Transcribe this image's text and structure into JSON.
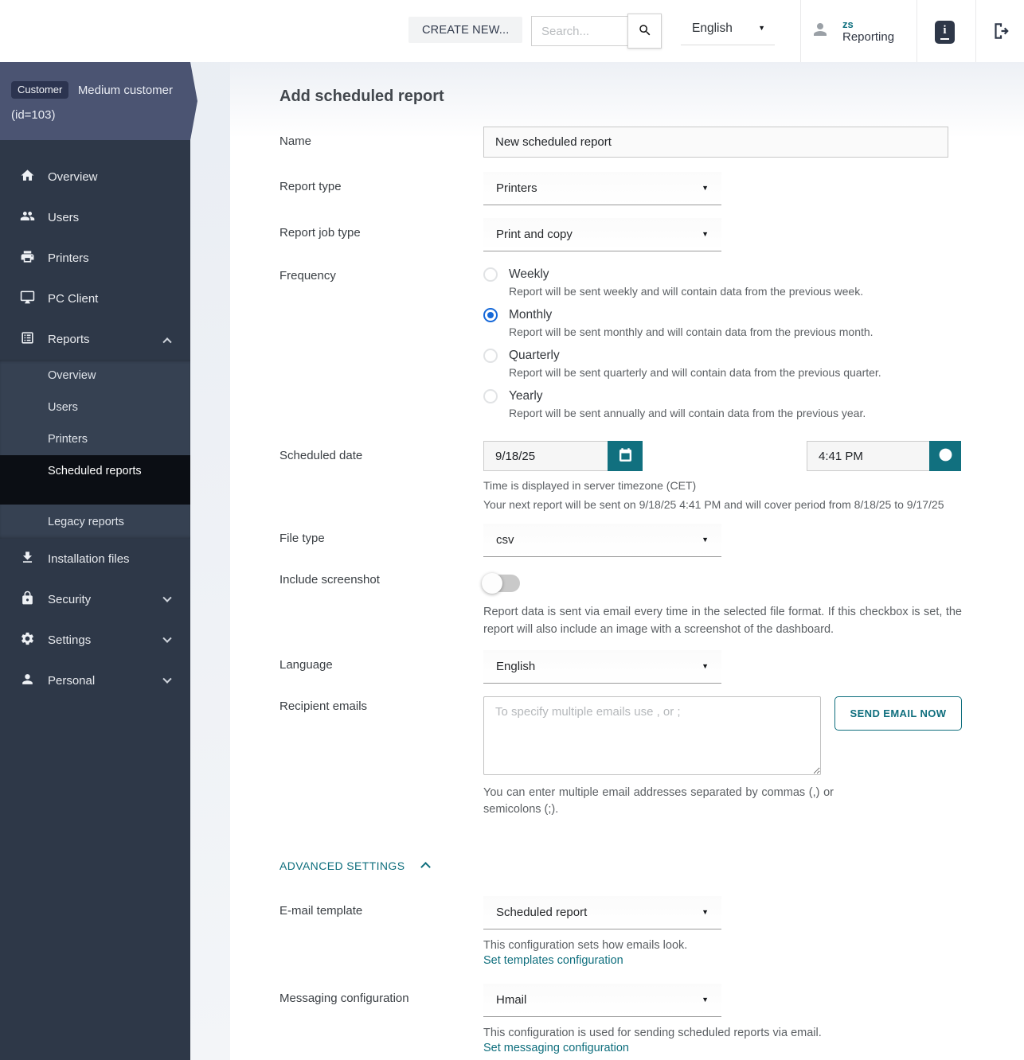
{
  "header": {
    "create_new_label": "CREATE NEW...",
    "search_placeholder": "Search...",
    "language_value": "English",
    "user_initials": "zs",
    "user_name": "Reporting"
  },
  "sidebar": {
    "customer": {
      "badge": "Customer",
      "name": "Medium customer",
      "id_line": "(id=103)"
    },
    "nav": [
      {
        "label": "Overview",
        "icon": "home-icon"
      },
      {
        "label": "Users",
        "icon": "group-icon"
      },
      {
        "label": "Printers",
        "icon": "printer-icon"
      },
      {
        "label": "PC Client",
        "icon": "monitor-icon"
      },
      {
        "label": "Reports",
        "icon": "report-list-icon",
        "expanded": true
      }
    ],
    "reports_submenu": [
      {
        "label": "Overview",
        "active": false
      },
      {
        "label": "Users",
        "active": false
      },
      {
        "label": "Printers",
        "active": false
      },
      {
        "label": "Scheduled reports",
        "active": true
      },
      {
        "label": "Legacy reports",
        "active": false
      }
    ],
    "nav_bottom": [
      {
        "label": "Installation files",
        "icon": "download-icon",
        "collapsible": false
      },
      {
        "label": "Security",
        "icon": "lock-icon",
        "collapsible": true
      },
      {
        "label": "Settings",
        "icon": "gear-icon",
        "collapsible": true
      },
      {
        "label": "Personal",
        "icon": "person-icon",
        "collapsible": true
      }
    ]
  },
  "form": {
    "title": "Add scheduled report",
    "name": {
      "label": "Name",
      "value": "New scheduled report"
    },
    "report_type": {
      "label": "Report type",
      "value": "Printers"
    },
    "report_job_type": {
      "label": "Report job type",
      "value": "Print and copy"
    },
    "frequency": {
      "label": "Frequency",
      "options": [
        {
          "label": "Weekly",
          "description": "Report will be sent weekly and will contain data from the previous week.",
          "selected": false
        },
        {
          "label": "Monthly",
          "description": "Report will be sent monthly and will contain data from the previous month.",
          "selected": true
        },
        {
          "label": "Quarterly",
          "description": "Report will be sent quarterly and will contain data from the previous quarter.",
          "selected": false
        },
        {
          "label": "Yearly",
          "description": "Report will be sent annually and will contain data from the previous year.",
          "selected": false
        }
      ]
    },
    "scheduled_date": {
      "label": "Scheduled date",
      "date_value": "9/18/25",
      "time_value": "4:41 PM",
      "timezone_note": "Time is displayed in server timezone (CET)",
      "next_report_note": "Your next report will be sent on 9/18/25 4:41 PM and will cover period from 8/18/25 to 9/17/25"
    },
    "file_type": {
      "label": "File type",
      "value": "csv"
    },
    "include_screenshot": {
      "label": "Include screenshot",
      "enabled": false,
      "description": "Report data is sent via email every time in the selected file format. If this checkbox is set, the report will also include an image with a screenshot of the dashboard."
    },
    "language": {
      "label": "Language",
      "value": "English"
    },
    "recipient_emails": {
      "label": "Recipient emails",
      "placeholder": "To specify multiple emails use , or ;",
      "send_button_label": "SEND EMAIL NOW",
      "help": "You can enter multiple email addresses separated by commas (,) or semicolons (;)."
    },
    "advanced_settings_label": "ADVANCED SETTINGS",
    "email_template": {
      "label": "E-mail template",
      "value": "Scheduled report",
      "help": "This configuration sets how emails look.",
      "link": "Set templates configuration"
    },
    "messaging_configuration": {
      "label": "Messaging configuration",
      "value": "Hmail",
      "help": "This configuration is used for sending scheduled reports via email.",
      "link": "Set messaging configuration"
    }
  },
  "colors": {
    "accent_teal": "#0e6e7d",
    "teal_button": "#11707f",
    "radio_selected_blue": "#1669d9",
    "sidebar_bg": "#2e3848",
    "sidebar_submenu_bg": "#364152",
    "sidebar_active_bg": "#0b0e14",
    "customer_banner_bg": "#4b5472",
    "customer_chip_bg": "#2c3450"
  }
}
